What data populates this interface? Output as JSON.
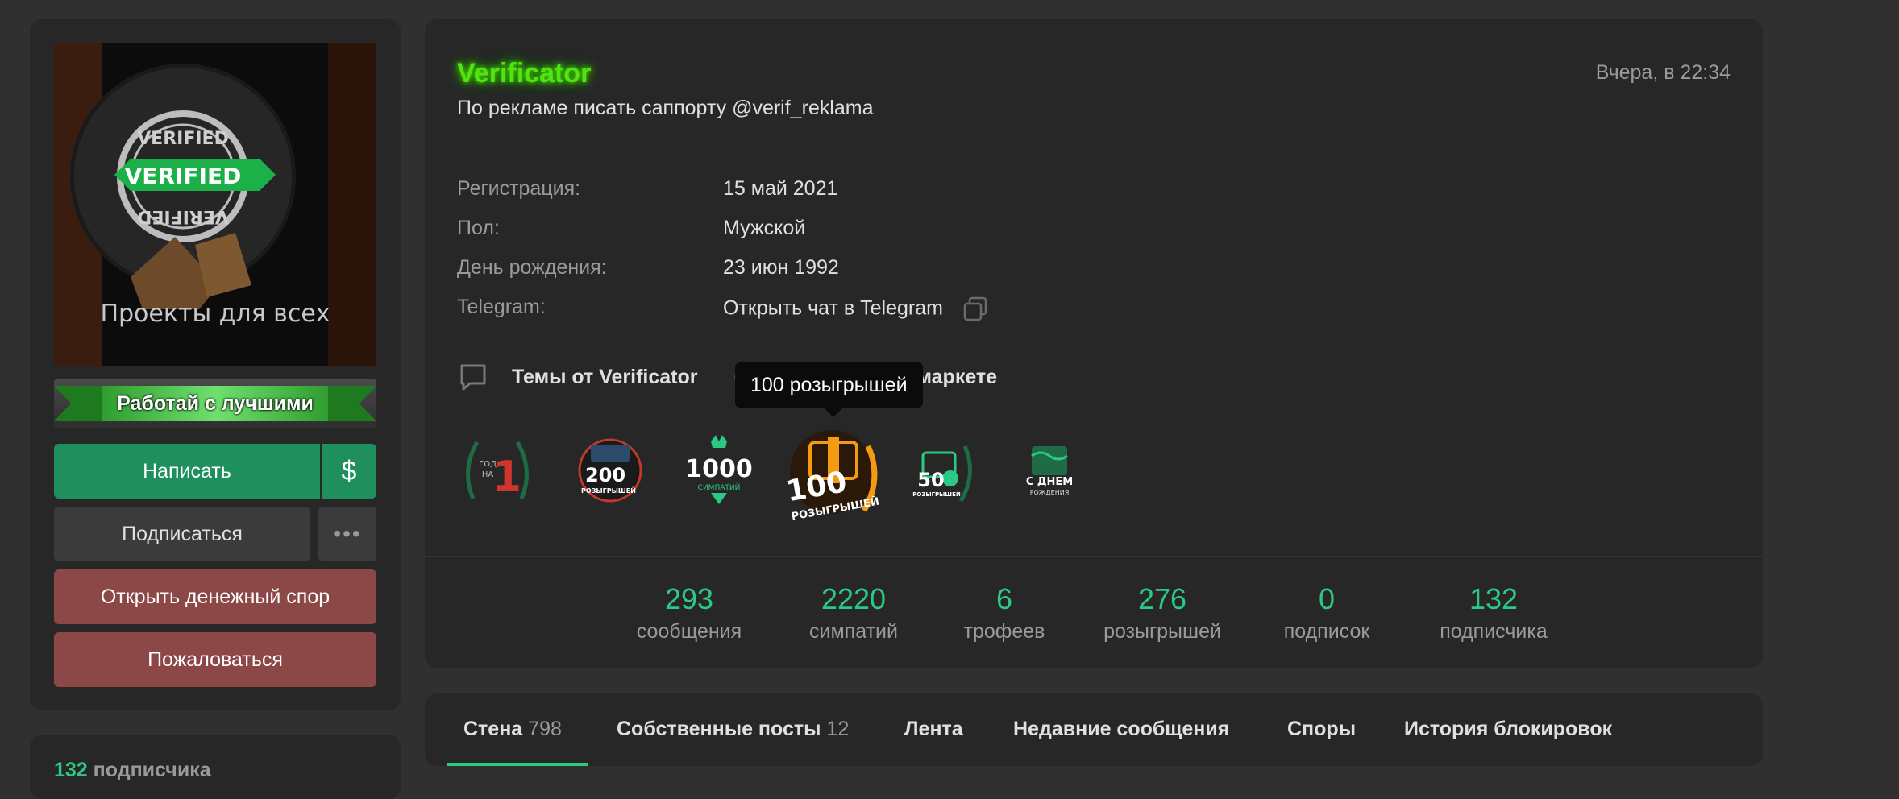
{
  "sidebar": {
    "avatar_text": "Проекты для всех",
    "avatar_stamp": "VERIFIED",
    "banner_text": "Работай с лучшими",
    "write_button": "Написать",
    "dollar_button": "$",
    "subscribe_button": "Подписаться",
    "more_button": "•••",
    "dispute_button": "Открыть денежный спор",
    "report_button": "Пожаловаться"
  },
  "sidebar2": {
    "followers_count": "132",
    "followers_label": "подписчика"
  },
  "profile": {
    "username": "Verificator",
    "status": "По рекламе писать саппорту @verif_reklama",
    "date": "Вчера, в 22:34",
    "info": [
      {
        "key": "Регистрация:",
        "value": "15 май 2021"
      },
      {
        "key": "Пол:",
        "value": "Мужской"
      },
      {
        "key": "День рождения:",
        "value": "23 июн 1992"
      },
      {
        "key": "Telegram:",
        "value": "Открыть чат в Telegram"
      }
    ],
    "topics_link": "Темы от Verificator",
    "market_link": "Аккаунты на маркете",
    "tooltip": "100 розыгрышей"
  },
  "trophies": [
    {
      "name": "1 год на форуме",
      "top": "ГОД",
      "big": "1",
      "bottom": "НА"
    },
    {
      "name": "200 розыгрышей",
      "big": "200",
      "bottom": "РОЗЫГРЫШЕЙ"
    },
    {
      "name": "1000 симпатий",
      "big": "1000",
      "bottom": "СИМПАТИЙ"
    },
    {
      "name": "100 розыгрышей",
      "big": "100",
      "bottom": "РОЗЫГРЫШЕЙ"
    },
    {
      "name": "50 розыгрышей",
      "big": "50",
      "bottom": "РОЗЫГРЫШЕЙ"
    },
    {
      "name": "С днем рождения",
      "big": "С ДНЕМ",
      "bottom": "РОЖДЕНИЯ"
    }
  ],
  "stats": [
    {
      "value": "293",
      "label": "сообщения"
    },
    {
      "value": "2220",
      "label": "симпатий"
    },
    {
      "value": "6",
      "label": "трофеев"
    },
    {
      "value": "276",
      "label": "розыгрышей"
    },
    {
      "value": "0",
      "label": "подписок"
    },
    {
      "value": "132",
      "label": "подписчика"
    }
  ],
  "tabs": [
    {
      "label": "Стена",
      "count": "798"
    },
    {
      "label": "Собственные посты",
      "count": "12"
    },
    {
      "label": "Лента",
      "count": ""
    },
    {
      "label": "Недавние сообщения",
      "count": ""
    },
    {
      "label": "Споры",
      "count": ""
    },
    {
      "label": "История блокировок",
      "count": ""
    }
  ],
  "colors": {
    "accent": "#2cc985",
    "button_green": "#1f8f5e",
    "button_red": "#8c4747",
    "username_glow": "#54e30f"
  }
}
